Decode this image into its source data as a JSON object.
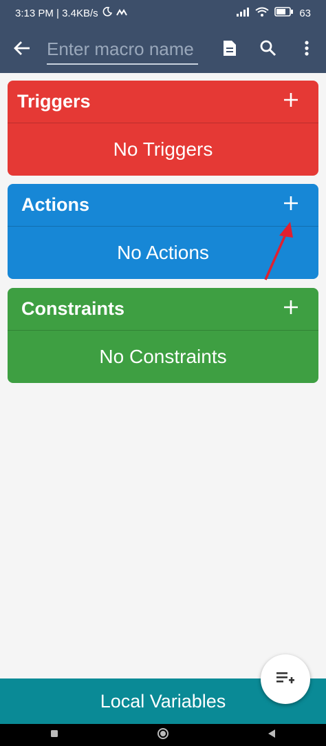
{
  "status_bar": {
    "time_speed": "3:13 PM | 3.4KB/s",
    "battery": "63"
  },
  "app_bar": {
    "name_placeholder": "Enter macro name"
  },
  "triggers": {
    "title": "Triggers",
    "empty_text": "No Triggers"
  },
  "actions": {
    "title": "Actions",
    "empty_text": "No Actions"
  },
  "constraints": {
    "title": "Constraints",
    "empty_text": "No Constraints"
  },
  "footer": {
    "label": "Local Variables"
  },
  "colors": {
    "app_bar": "#3d4f6a",
    "triggers": "#e53935",
    "actions": "#1787d6",
    "constraints": "#3e9f42",
    "footer": "#0a8a96",
    "annotation_arrow": "#e02030"
  }
}
